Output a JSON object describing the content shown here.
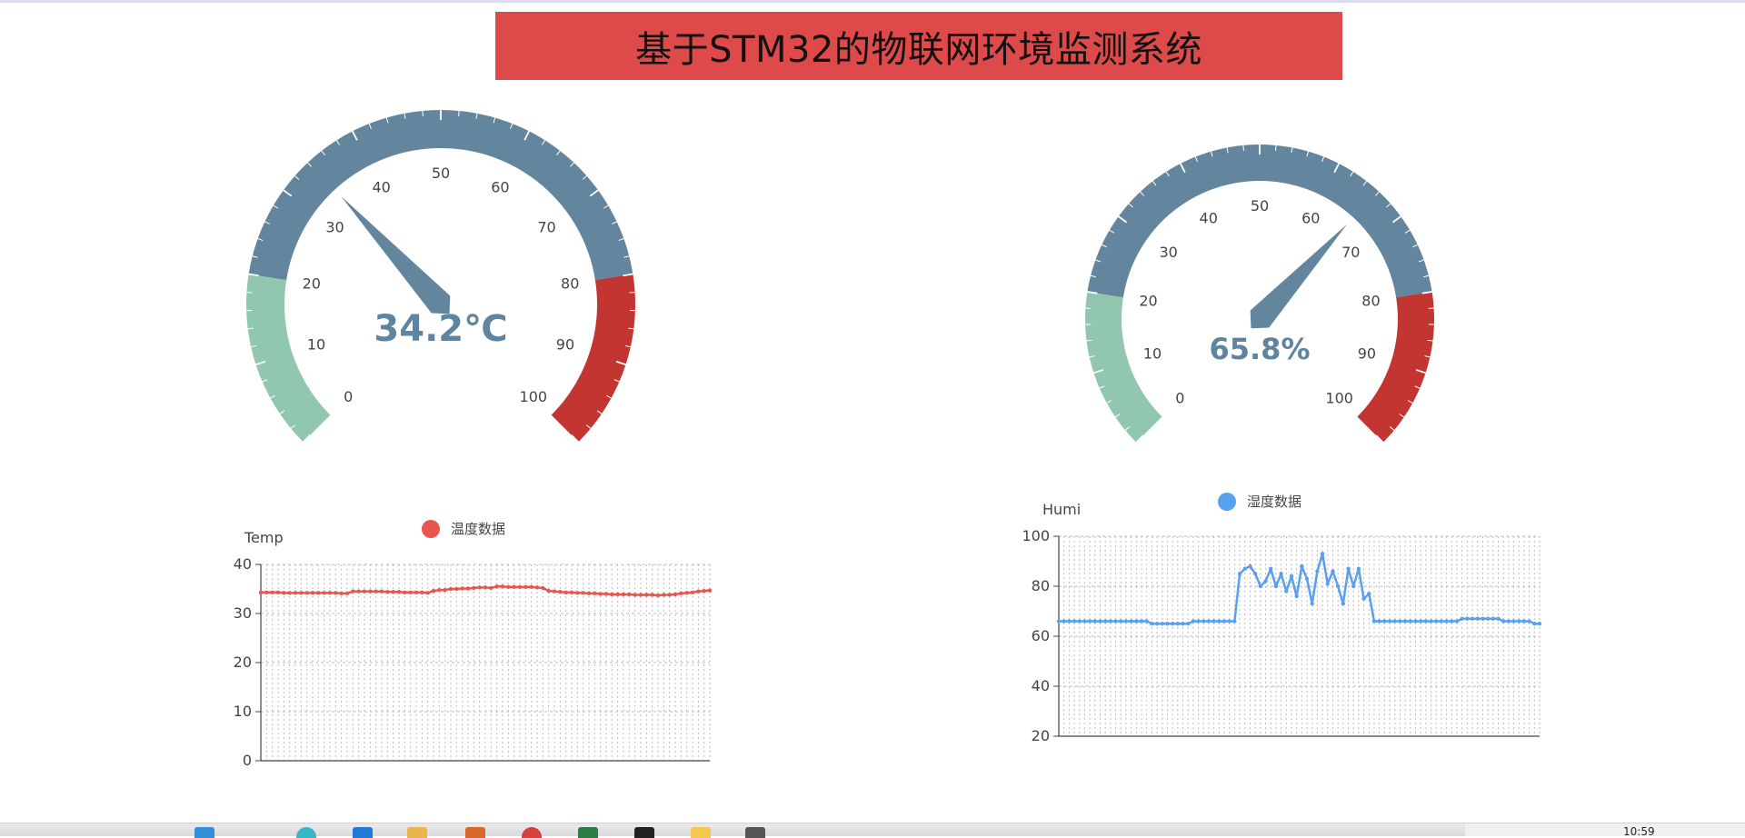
{
  "title": "基于STM32的物联网环境监测系统",
  "colors": {
    "banner": "#de4a4a",
    "gauge_low": "#91c7ae",
    "gauge_mid": "#63869e",
    "gauge_high": "#c23531",
    "temp_line": "#e8564e",
    "humi_line": "#5aa0f0"
  },
  "gauges": [
    {
      "id": "temp",
      "value": 34.2,
      "value_text": "34.2℃",
      "min": 0,
      "max": 100,
      "ticks": [
        "0",
        "10",
        "20",
        "30",
        "40",
        "50",
        "60",
        "70",
        "80",
        "90",
        "100"
      ],
      "bands": [
        [
          0.2,
          "#91c7ae"
        ],
        [
          0.8,
          "#63869e"
        ],
        [
          1,
          "#c23531"
        ]
      ]
    },
    {
      "id": "humi",
      "value": 65.8,
      "value_text": "65.8%",
      "min": 0,
      "max": 100,
      "ticks": [
        "0",
        "10",
        "20",
        "30",
        "40",
        "50",
        "60",
        "70",
        "80",
        "90",
        "100"
      ],
      "bands": [
        [
          0.2,
          "#91c7ae"
        ],
        [
          0.8,
          "#63869e"
        ],
        [
          1,
          "#c23531"
        ]
      ]
    }
  ],
  "chart_data": [
    {
      "type": "line",
      "title": "",
      "ylabel": "Temp",
      "xlabel": "",
      "ylim": [
        0,
        40
      ],
      "yticks": [
        "0",
        "10",
        "20",
        "30",
        "40"
      ],
      "grid": true,
      "legend_position": "top-center",
      "series": [
        {
          "name": "温度数据",
          "values": [
            34.3,
            34.3,
            34.3,
            34.3,
            34.2,
            34.2,
            34.2,
            34.2,
            34.2,
            34.2,
            34.2,
            34.2,
            34.2,
            34.2,
            34.1,
            34.1,
            34.5,
            34.5,
            34.5,
            34.5,
            34.5,
            34.5,
            34.4,
            34.4,
            34.4,
            34.3,
            34.3,
            34.3,
            34.3,
            34.2,
            34.6,
            34.8,
            34.8,
            35.0,
            35.0,
            35.1,
            35.1,
            35.2,
            35.3,
            35.3,
            35.2,
            35.5,
            35.5,
            35.4,
            35.4,
            35.4,
            35.4,
            35.4,
            35.3,
            35.2,
            34.6,
            34.5,
            34.4,
            34.3,
            34.3,
            34.2,
            34.2,
            34.1,
            34.1,
            34.0,
            34.0,
            33.9,
            33.9,
            33.9,
            33.9,
            33.8,
            33.8,
            33.8,
            33.8,
            33.7,
            33.8,
            33.8,
            33.9,
            34.1,
            34.2,
            34.3,
            34.5,
            34.6,
            34.7
          ]
        }
      ]
    },
    {
      "type": "line",
      "title": "",
      "ylabel": "Humi",
      "xlabel": "",
      "ylim": [
        20,
        100
      ],
      "yticks": [
        "20",
        "40",
        "60",
        "80",
        "100"
      ],
      "grid": true,
      "legend_position": "top-center",
      "series": [
        {
          "name": "湿度数据",
          "values": [
            66,
            66,
            66,
            66,
            66,
            66,
            66,
            66,
            66,
            66,
            66,
            66,
            66,
            66,
            66,
            66,
            66,
            66,
            65,
            65,
            65,
            65,
            65,
            65,
            65,
            65,
            66,
            66,
            66,
            66,
            66,
            66,
            66,
            66,
            66,
            85,
            87,
            88,
            85,
            80,
            82,
            87,
            80,
            85,
            78,
            84,
            76,
            88,
            83,
            73,
            86,
            93,
            81,
            86,
            80,
            73,
            87,
            80,
            87,
            75,
            77,
            66,
            66,
            66,
            66,
            66,
            66,
            66,
            66,
            66,
            66,
            66,
            66,
            66,
            66,
            66,
            66,
            66,
            67,
            67,
            67,
            67,
            67,
            67,
            67,
            67,
            66,
            66,
            66,
            66,
            66,
            66,
            65,
            65
          ]
        }
      ]
    }
  ]
}
